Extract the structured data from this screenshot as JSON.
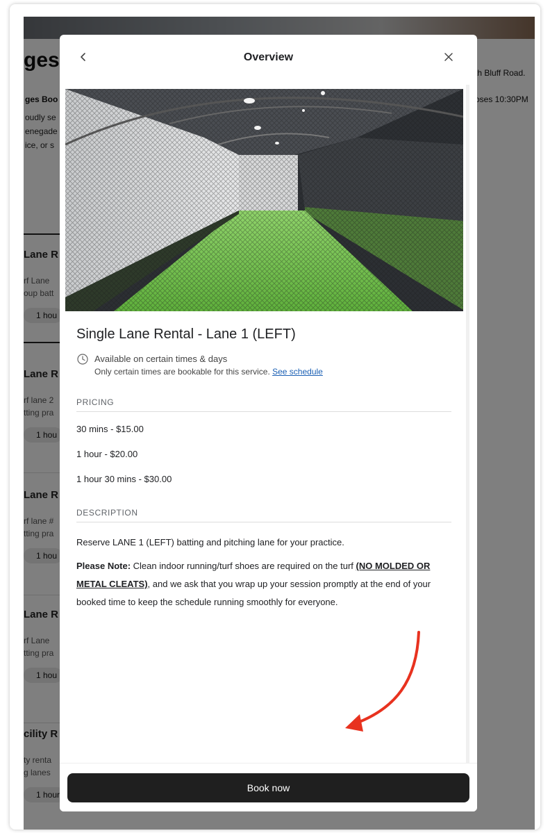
{
  "background": {
    "page_title": "ges",
    "intro_bold": "ges Boo",
    "intro_lines": [
      "oudly se",
      "enegade",
      "ice, or s"
    ],
    "right_lines": [
      "th Bluff Road.",
      "oses 10:30PM"
    ],
    "cards": [
      {
        "title": "Lane R",
        "lines": [
          "rf Lane",
          "oup batt"
        ],
        "chip": "1 hou"
      },
      {
        "title": "Lane R",
        "lines": [
          "rf lane 2",
          "tting pra"
        ],
        "chip": "1 hou"
      },
      {
        "title": "Lane R",
        "lines": [
          "rf lane #",
          "tting pra"
        ],
        "chip": "1 hou"
      },
      {
        "title": "Lane R",
        "lines": [
          "rf Lane",
          "tting pra"
        ],
        "chip": "1 hou"
      },
      {
        "title": "cility R",
        "lines": [
          "ty renta",
          "g lanes"
        ],
        "chip": "1 hour"
      }
    ]
  },
  "modal": {
    "title": "Overview",
    "back_icon": "chevron-left-icon",
    "close_icon": "close-icon",
    "service_title": "Single Lane Rental - Lane 1 (LEFT)",
    "availability": {
      "main": "Available on certain times & days",
      "sub": "Only certain times are bookable for this service.",
      "link": "See schedule"
    },
    "pricing_header": "PRICING",
    "prices": [
      "30 mins - $15.00",
      "1 hour - $20.00",
      "1 hour 30 mins - $30.00"
    ],
    "description_header": "DESCRIPTION",
    "description": {
      "line1": "Reserve LANE 1 (LEFT) batting and pitching lane for your practice.",
      "note_label": "Please Note:",
      "note_text_a": " Clean indoor running/turf shoes are required on the turf ",
      "note_underlined": "(NO MOLDED OR METAL CLEATS)",
      "note_text_b": ", and we ask that you wrap up your session promptly at the end of your booked time to keep the schedule running smoothly for everyone."
    },
    "book_button": "Book now"
  },
  "colors": {
    "button_bg": "#1f1f1f",
    "link": "#1a5fb4",
    "turf": "#6cc04a",
    "annotation_arrow": "#e8321f"
  }
}
